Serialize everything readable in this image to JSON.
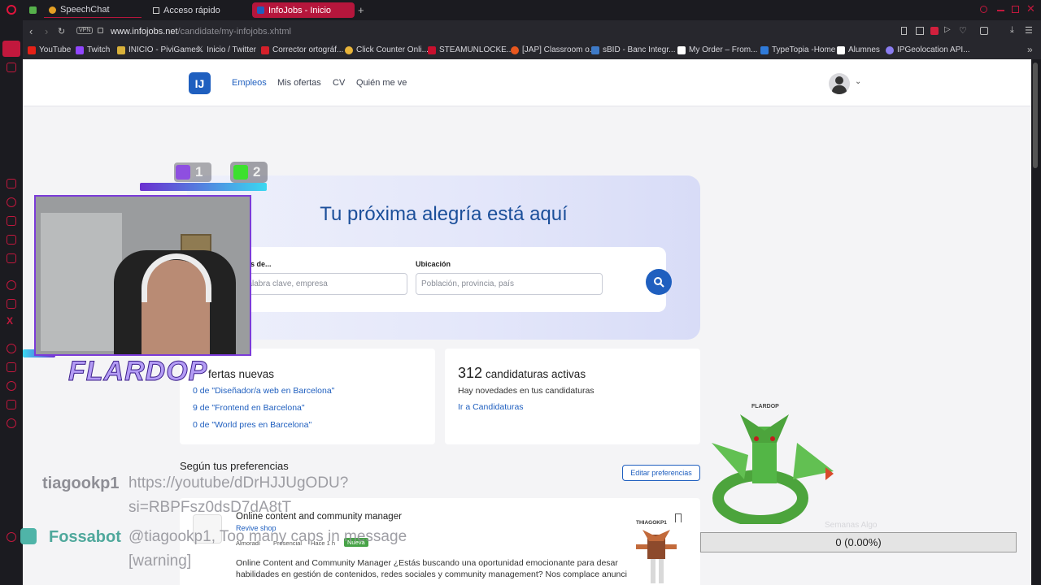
{
  "tabs": [
    {
      "label": "SpeechChat"
    },
    {
      "label": "Acceso rápido"
    },
    {
      "label": "InfoJobs - Inicio"
    }
  ],
  "address": {
    "vpn": "VPN",
    "url_domain": "www.infojobs.net",
    "url_path": "/candidate/my-infojobs.xhtml"
  },
  "bookmarks": [
    {
      "label": "YouTube",
      "color": "#e62117"
    },
    {
      "label": "Twitch",
      "color": "#9146ff"
    },
    {
      "label": "INICIO - PiviGames",
      "color": "#d9b13a"
    },
    {
      "label": "Inicio / Twitter",
      "color": "#ffffff"
    },
    {
      "label": "Corrector ortográf...",
      "color": "#d4202a"
    },
    {
      "label": "Click Counter Onli...",
      "color": "#e8b43a"
    },
    {
      "label": "STEAMUNLOCKE...",
      "color": "#c8102e"
    },
    {
      "label": "[JAP] Classroom o...",
      "color": "#e8571e"
    },
    {
      "label": "sBID - Banc Integr...",
      "color": "#3e7ac7"
    },
    {
      "label": "My Order – From...",
      "color": "#ffffff"
    },
    {
      "label": "TypeTopia -Home",
      "color": "#2f7ad9"
    },
    {
      "label": "Alumnes",
      "color": "#ffffff"
    },
    {
      "label": "IPGeolocation API...",
      "color": "#8a7cf0"
    }
  ],
  "site": {
    "logo": "IJ",
    "nav": [
      "Empleos",
      "Mis ofertas",
      "CV",
      "Quién me ve"
    ],
    "hero_title": "Tu próxima alegría está aquí",
    "search": {
      "what_label": "o ofertas de...",
      "what_placeholder": "sto, palabra clave, empresa",
      "where_label": "Ubicación",
      "where_placeholder": "Población, provincia, país"
    },
    "offers_card": {
      "title": "fertas nuevas",
      "links": [
        "0 de \"Diseñador/a web en Barcelona\"",
        "9 de \"Frontend en Barcelona\"",
        "0 de \"World pres en Barcelona\""
      ]
    },
    "applications_card": {
      "count": "312",
      "title": "candidaturas activas",
      "subtitle": "Hay novedades en tus candidaturas",
      "link": "Ir a Candidaturas"
    },
    "preferences": {
      "title": "Según tus preferencias",
      "edit_button": "Editar preferencias",
      "job": {
        "title": "Online content and community manager",
        "company": "Revive shop",
        "meta": [
          "Almoradí",
          "Presencial",
          "Hace 1 h"
        ],
        "badge": "Nueva",
        "description_1": "Online Content and Community Manager ¿Estás buscando una oportunidad emocionante para desar",
        "description_2": "habilidades en gestión de contenidos, redes sociales y community management? Nos complace anunci"
      }
    }
  },
  "stream": {
    "twitch_count": "1",
    "kick_count": "2",
    "streamer_name": "FLARDOP",
    "chat": [
      {
        "user": "tiagookp1",
        "message_1": "https://youtube/dDrHJJUgODU?",
        "message_2": "si=RBPFsz0dsD7dA8tT"
      },
      {
        "user": "Fossabot",
        "message_1": "@tiagookp1, Too many caps in message",
        "message_2": "[warning]"
      }
    ],
    "pet_label": "FLARDOP",
    "follower_label": "THIAGOKP1",
    "meter_value": "0 (0.00%)",
    "meter_label": "Semanas Algo"
  }
}
